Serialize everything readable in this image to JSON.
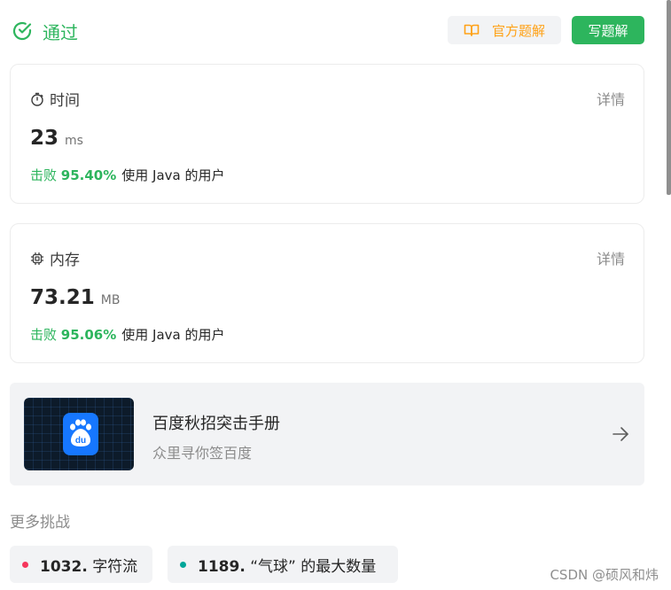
{
  "status": {
    "text": "通过",
    "color": "#2db55d",
    "icon": "check-circle-icon"
  },
  "actions": {
    "official_label": "官方题解",
    "official_icon": "book-icon",
    "write_label": "写题解"
  },
  "time_card": {
    "title": "时间",
    "icon": "timer-icon",
    "detail_label": "详情",
    "value": "23",
    "unit": "ms",
    "beat_prefix": "击败",
    "beat_percent": "95.40%",
    "beat_suffix": "使用 Java 的用户"
  },
  "memory_card": {
    "title": "内存",
    "icon": "chip-icon",
    "detail_label": "详情",
    "value": "73.21",
    "unit": "MB",
    "beat_prefix": "击败",
    "beat_percent": "95.06%",
    "beat_suffix": "使用 Java 的用户"
  },
  "ad": {
    "title": "百度秋招突击手册",
    "subtitle": "众里寻你签百度",
    "logo_text": "du",
    "arrow_icon": "arrow-right-icon"
  },
  "more": {
    "title": "更多挑战",
    "items": [
      {
        "id": "1032.",
        "name": "字符流",
        "dot_color": "#f5365c"
      },
      {
        "id": "1189.",
        "name": "“气球” 的最大数量",
        "dot_color": "#00a699"
      }
    ]
  },
  "watermark": "CSDN @硕风和炜"
}
